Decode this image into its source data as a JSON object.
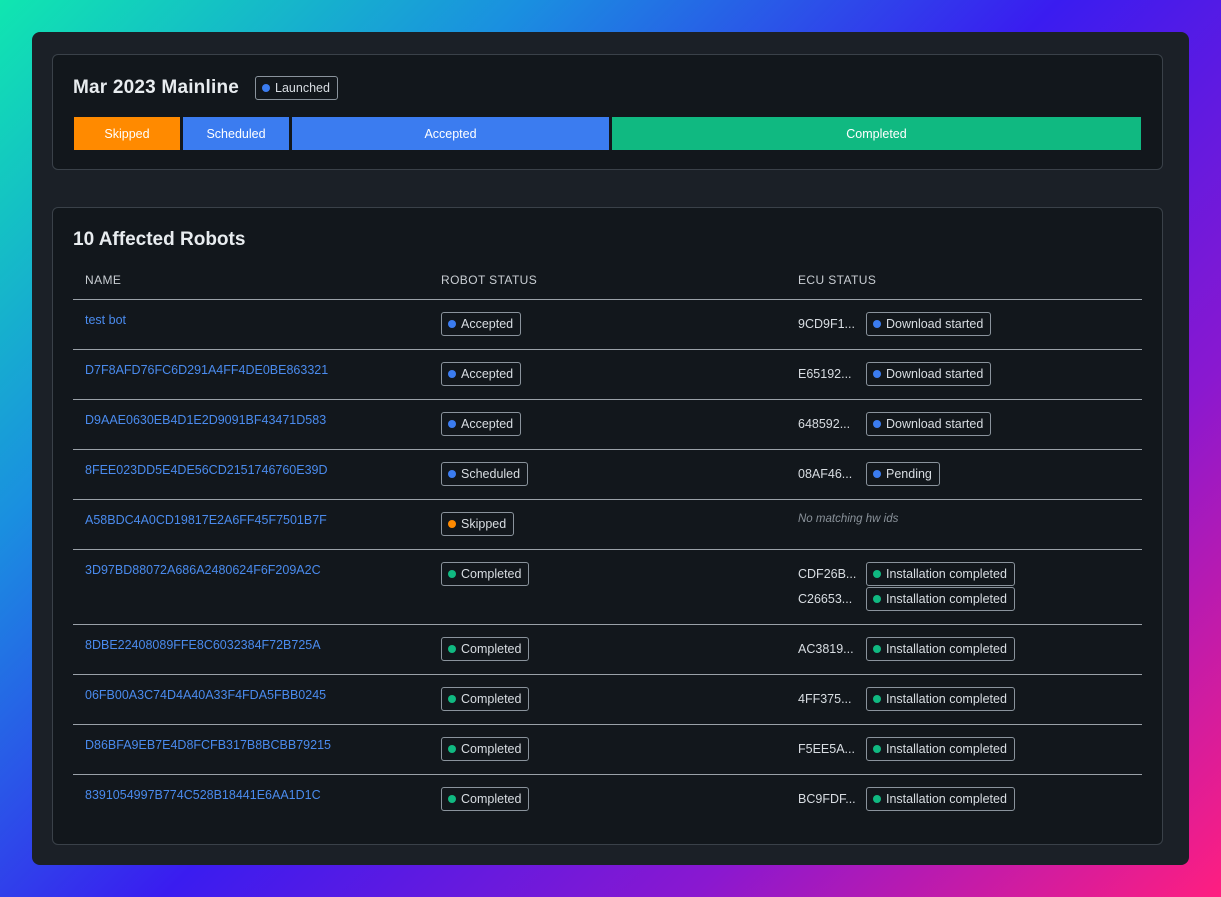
{
  "release": {
    "title": "Mar 2023 Mainline",
    "status": {
      "label": "Launched",
      "color": "#3b7cf0"
    }
  },
  "progress_bar": {
    "segments": [
      {
        "label": "Skipped",
        "color": "#ff8a00",
        "fraction": 0.1
      },
      {
        "label": "Scheduled",
        "color": "#3b7cf0",
        "fraction": 0.1
      },
      {
        "label": "Accepted",
        "color": "#3b7cf0",
        "fraction": 0.3
      },
      {
        "label": "Completed",
        "color": "#10b981",
        "fraction": 0.5
      }
    ]
  },
  "robots": {
    "title": "10 Affected Robots",
    "columns": {
      "name": "NAME",
      "robot_status": "ROBOT STATUS",
      "ecu_status": "ECU STATUS"
    },
    "empty_ecu_text": "No matching hw ids",
    "status_colors": {
      "Accepted": "#3b7cf0",
      "Scheduled": "#3b7cf0",
      "Skipped": "#ff8a00",
      "Completed": "#10b981"
    },
    "ecu_colors": {
      "Download started": "#3b7cf0",
      "Pending": "#3b7cf0",
      "Installation completed": "#10b981"
    },
    "rows": [
      {
        "name": "test bot",
        "status": "Accepted",
        "ecus": [
          {
            "id": "9CD9F1...",
            "status": "Download started"
          }
        ]
      },
      {
        "name": "D7F8AFD76FC6D291A4FF4DE0BE863321",
        "status": "Accepted",
        "ecus": [
          {
            "id": "E65192...",
            "status": "Download started"
          }
        ]
      },
      {
        "name": "D9AAE0630EB4D1E2D9091BF43471D583",
        "status": "Accepted",
        "ecus": [
          {
            "id": "648592...",
            "status": "Download started"
          }
        ]
      },
      {
        "name": "8FEE023DD5E4DE56CD2151746760E39D",
        "status": "Scheduled",
        "ecus": [
          {
            "id": "08AF46...",
            "status": "Pending"
          }
        ]
      },
      {
        "name": "A58BDC4A0CD19817E2A6FF45F7501B7F",
        "status": "Skipped",
        "ecus": []
      },
      {
        "name": "3D97BD88072A686A2480624F6F209A2C",
        "status": "Completed",
        "ecus": [
          {
            "id": "CDF26B...",
            "status": "Installation completed"
          },
          {
            "id": "C26653...",
            "status": "Installation completed"
          }
        ]
      },
      {
        "name": "8DBE22408089FFE8C6032384F72B725A",
        "status": "Completed",
        "ecus": [
          {
            "id": "AC3819...",
            "status": "Installation completed"
          }
        ]
      },
      {
        "name": "06FB00A3C74D4A40A33F4FDA5FBB0245",
        "status": "Completed",
        "ecus": [
          {
            "id": "4FF375...",
            "status": "Installation completed"
          }
        ]
      },
      {
        "name": "D86BFA9EB7E4D8FCFB317B8BCBB79215",
        "status": "Completed",
        "ecus": [
          {
            "id": "F5EE5A...",
            "status": "Installation completed"
          }
        ]
      },
      {
        "name": "8391054997B774C528B18441E6AA1D1C",
        "status": "Completed",
        "ecus": [
          {
            "id": "BC9FDF...",
            "status": "Installation completed"
          }
        ]
      }
    ]
  }
}
